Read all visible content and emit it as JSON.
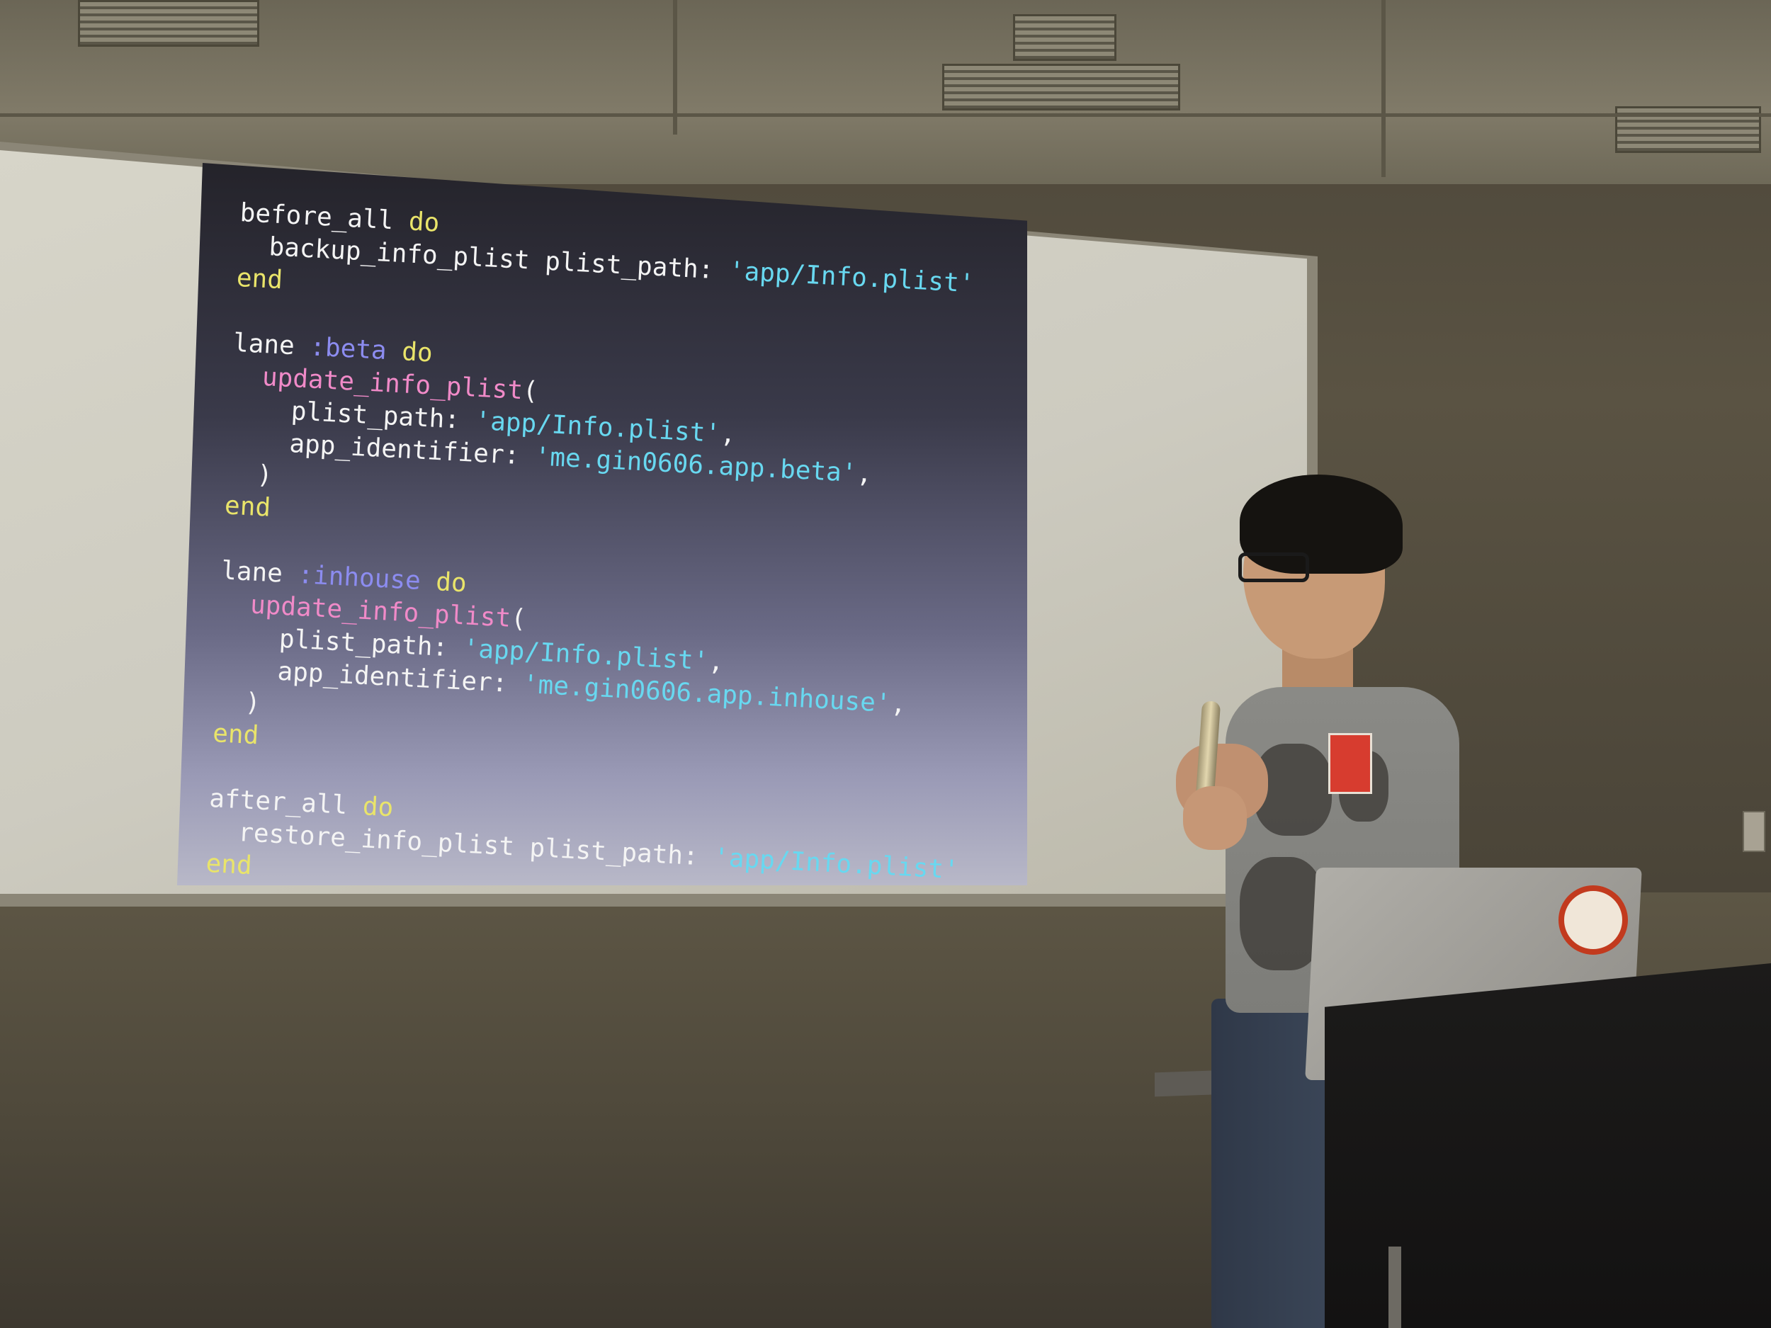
{
  "slide": {
    "lines": [
      {
        "parts": [
          {
            "t": "before_all",
            "c": "plain"
          },
          {
            "t": " do",
            "c": "kw"
          }
        ]
      },
      {
        "parts": [
          {
            "t": "  backup_info_plist plist_path: ",
            "c": "plain"
          },
          {
            "t": "'app/Info.plist'",
            "c": "str"
          }
        ]
      },
      {
        "parts": [
          {
            "t": "end",
            "c": "kw"
          }
        ]
      },
      {
        "parts": [
          {
            "t": "",
            "c": "plain"
          }
        ]
      },
      {
        "parts": [
          {
            "t": "lane ",
            "c": "plain"
          },
          {
            "t": ":beta",
            "c": "sym"
          },
          {
            "t": " do",
            "c": "kw"
          }
        ]
      },
      {
        "parts": [
          {
            "t": "  update_info_plist",
            "c": "fn"
          },
          {
            "t": "(",
            "c": "punct"
          }
        ]
      },
      {
        "parts": [
          {
            "t": "    plist_path: ",
            "c": "plain"
          },
          {
            "t": "'app/Info.plist'",
            "c": "str"
          },
          {
            "t": ",",
            "c": "punct"
          }
        ]
      },
      {
        "parts": [
          {
            "t": "    app_identifier: ",
            "c": "plain"
          },
          {
            "t": "'me.gin0606.app.beta'",
            "c": "str"
          },
          {
            "t": ",",
            "c": "punct"
          }
        ]
      },
      {
        "parts": [
          {
            "t": "  )",
            "c": "punct"
          }
        ]
      },
      {
        "parts": [
          {
            "t": "end",
            "c": "kw"
          }
        ]
      },
      {
        "parts": [
          {
            "t": "",
            "c": "plain"
          }
        ]
      },
      {
        "parts": [
          {
            "t": "lane ",
            "c": "plain"
          },
          {
            "t": ":inhouse",
            "c": "sym"
          },
          {
            "t": " do",
            "c": "kw"
          }
        ]
      },
      {
        "parts": [
          {
            "t": "  update_info_plist",
            "c": "fn"
          },
          {
            "t": "(",
            "c": "punct"
          }
        ]
      },
      {
        "parts": [
          {
            "t": "    plist_path: ",
            "c": "plain"
          },
          {
            "t": "'app/Info.plist'",
            "c": "str"
          },
          {
            "t": ",",
            "c": "punct"
          }
        ]
      },
      {
        "parts": [
          {
            "t": "    app_identifier: ",
            "c": "plain"
          },
          {
            "t": "'me.gin0606.app.inhouse'",
            "c": "str"
          },
          {
            "t": ",",
            "c": "punct"
          }
        ]
      },
      {
        "parts": [
          {
            "t": "  )",
            "c": "punct"
          }
        ]
      },
      {
        "parts": [
          {
            "t": "end",
            "c": "kw"
          }
        ]
      },
      {
        "parts": [
          {
            "t": "",
            "c": "plain"
          }
        ]
      },
      {
        "parts": [
          {
            "t": "after_all",
            "c": "plain"
          },
          {
            "t": " do",
            "c": "kw"
          }
        ]
      },
      {
        "parts": [
          {
            "t": "  restore_info_plist plist_path: ",
            "c": "plain"
          },
          {
            "t": "'app/Info.plist'",
            "c": "str"
          }
        ]
      },
      {
        "parts": [
          {
            "t": "end",
            "c": "kw"
          }
        ]
      }
    ]
  },
  "colors": {
    "keyword": "#e9e46a",
    "symbol": "#8c8cf0",
    "function": "#f08ac8",
    "string": "#68d8f0",
    "plain": "#f4f4f4"
  },
  "icons": {
    "laptop_logo": "apple-logo-icon",
    "laptop_logo_glyph": ""
  }
}
